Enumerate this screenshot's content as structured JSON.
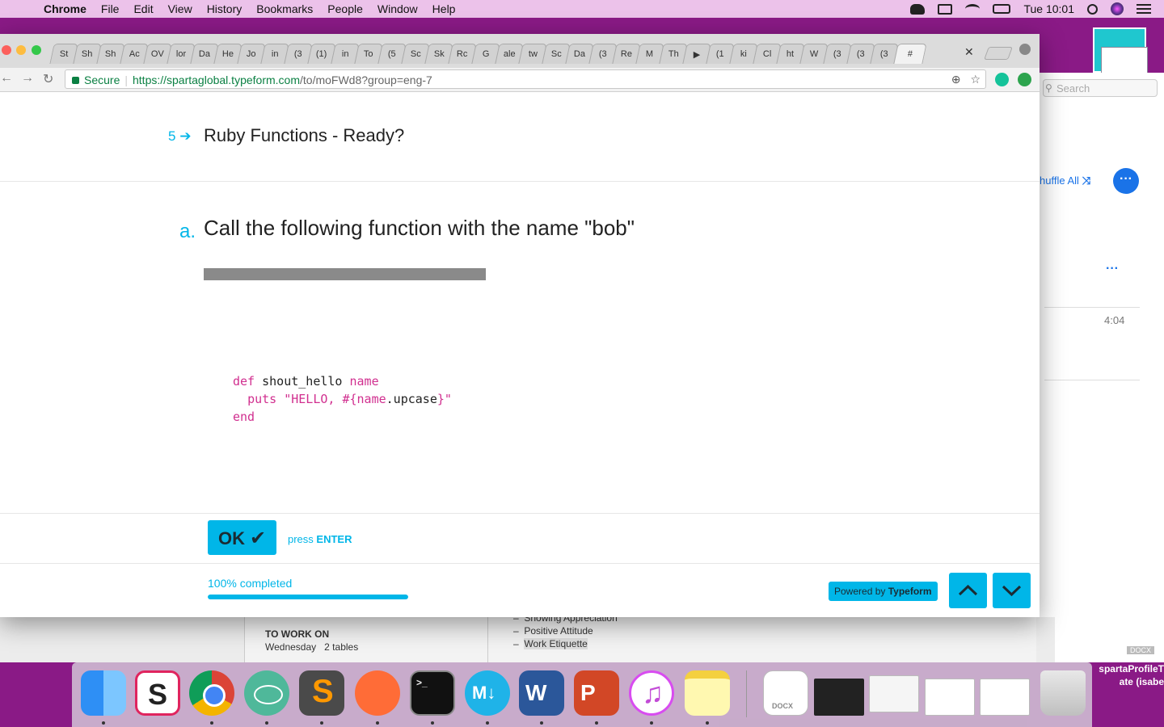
{
  "menubar": {
    "app": "Chrome",
    "menus": [
      "File",
      "Edit",
      "View",
      "History",
      "Bookmarks",
      "People",
      "Window",
      "Help"
    ],
    "clock": "Tue 10:01"
  },
  "browser": {
    "tabs": [
      "St",
      "Sh",
      "Sh",
      "Ac",
      "OV",
      "lor",
      "Da",
      "He",
      "Jo",
      "in",
      "(3",
      "(1)",
      "in",
      "To",
      "(5",
      "Sc",
      "Sk",
      "Rc",
      "G",
      "ale",
      "tw",
      "Sc",
      "Da",
      "(3",
      "Re",
      "M",
      "Th",
      "▶",
      "(1",
      "ki",
      "Cl",
      "ht",
      "W",
      "(3",
      "(3",
      "(3",
      "#"
    ],
    "active_tab": "#",
    "address": {
      "secure_label": "Secure",
      "host": "https://spartaglobal.typeform.com",
      "path": "/to/moFWd8?group=eng-7"
    }
  },
  "typeform": {
    "question_number": "5",
    "question_title": "Ruby Functions - Ready?",
    "sub_letter": "a.",
    "sub_question": "Call the following function with the name \"bob\"",
    "code": {
      "line1_kw": "def",
      "line1_fn": " shout_hello ",
      "line1_arg": "name",
      "line2_indent": "  ",
      "line2_fn": "puts",
      "line2_str_a": " \"HELLO, #{",
      "line2_var": "name",
      "line2_method": ".upcase",
      "line2_str_b": "}\"",
      "line3_kw": "end"
    },
    "ok_label": "OK",
    "press_prefix": "press",
    "press_key": "ENTER",
    "progress_label": "100% completed",
    "progress_fraction": 1.0,
    "powered_prefix": "Powered by",
    "powered_brand": "Typeform"
  },
  "background": {
    "search_placeholder": "Search",
    "shuffle_label": "huffle All",
    "track_time": "4:04",
    "doc_heading": "TO WORK ON",
    "doc_day": "Wednesday",
    "doc_tables": "2 tables",
    "doc_bullets": [
      "Showing Appreciation",
      "Positive Attitude",
      "Work Etiquette"
    ],
    "profile_file": "spartaProfileT ate (isabe",
    "docx_tag": "DOCX",
    "dock_docx_label": "DOCX"
  },
  "colors": {
    "accent": "#00b6e8",
    "menubar": "#ecc2ea",
    "desktop": "#8a1a86"
  }
}
